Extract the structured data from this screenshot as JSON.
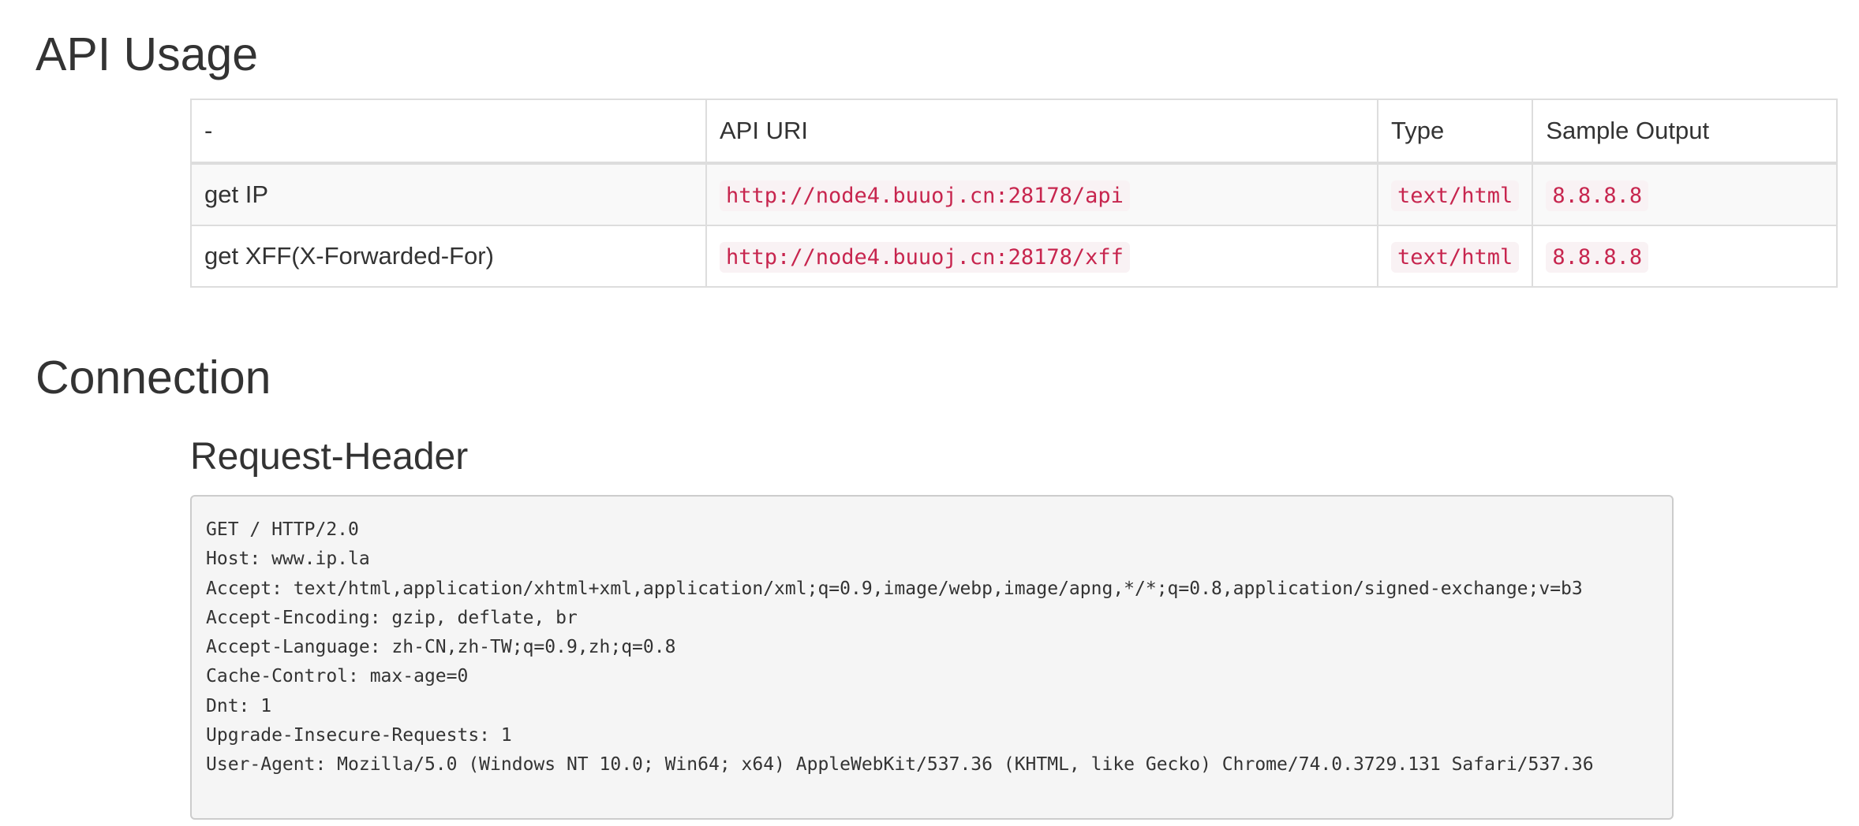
{
  "api_usage": {
    "heading": "API Usage",
    "headers": [
      "-",
      "API URI",
      "Type",
      "Sample Output"
    ],
    "rows": [
      {
        "name": "get IP",
        "uri": "http://node4.buuoj.cn:28178/api",
        "type": "text/html",
        "sample": "8.8.8.8"
      },
      {
        "name": "get XFF(X-Forwarded-For)",
        "uri": "http://node4.buuoj.cn:28178/xff",
        "type": "text/html",
        "sample": "8.8.8.8"
      }
    ]
  },
  "connection": {
    "heading": "Connection",
    "subheading": "Request-Header",
    "lines": [
      "GET / HTTP/2.0",
      "Host: www.ip.la",
      "Accept: text/html,application/xhtml+xml,application/xml;q=0.9,image/webp,image/apng,*/*;q=0.8,application/signed-exchange;v=b3",
      "Accept-Encoding: gzip, deflate, br",
      "Accept-Language: zh-CN,zh-TW;q=0.9,zh;q=0.8",
      "Cache-Control: max-age=0",
      "Dnt: 1",
      "Upgrade-Insecure-Requests: 1",
      "User-Agent: Mozilla/5.0 (Windows NT 10.0; Win64; x64) AppleWebKit/537.36 (KHTML, like Gecko) Chrome/74.0.3729.131 Safari/537.36"
    ]
  },
  "colors": {
    "code_text": "#c7254e",
    "code_background": "#f9f2f4",
    "pre_background": "#f5f5f5",
    "table_border": "#dddddd",
    "striped_row": "#f9f9f9"
  }
}
